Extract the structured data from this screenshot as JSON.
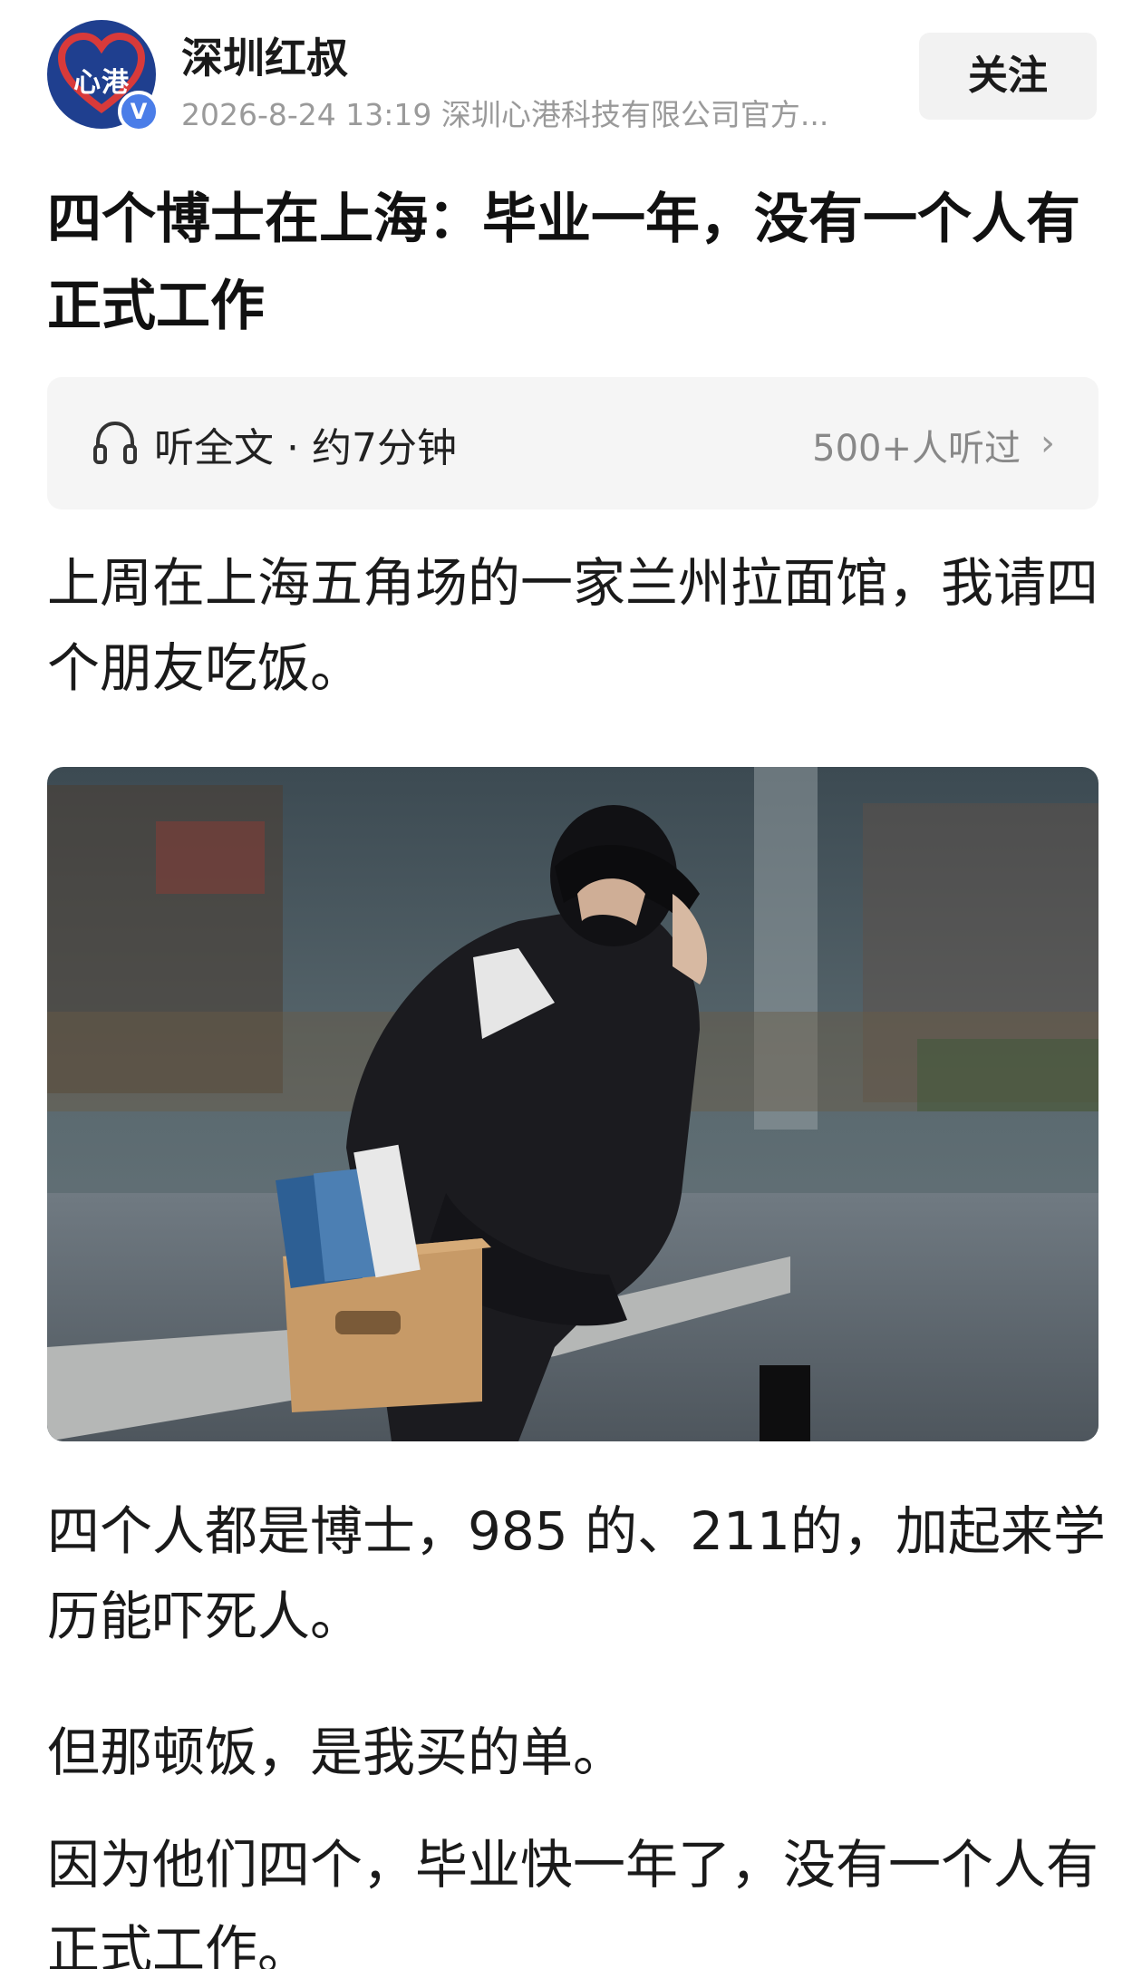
{
  "author": {
    "name": "深圳红叔",
    "avatar_text": "心港",
    "verified_mark": "V",
    "meta": "2026-8-24  13:19  深圳心港科技有限公司官方..."
  },
  "follow_label": "关注",
  "article": {
    "title": "四个博士在上海：毕业一年，没有一个人有正式工作",
    "listen": {
      "label": "听全文 · 约7分钟",
      "count": "500+人听过",
      "chevron": "›"
    },
    "paragraphs": [
      "上周在上海五角场的一家兰州拉面馆，我请四个朋友吃饭。",
      "四个人都是博士，985 的、211的，加起来学历能吓死人。",
      "但那顿饭，是我买的单。",
      "因为他们四个，毕业快一年了，没有一个人有正式工作。"
    ]
  },
  "colors": {
    "accent_blue": "#1f3f8f",
    "heart_red": "#d83a3a",
    "verified_blue": "#4a7de8"
  },
  "icons": {
    "listen": "headphones-icon",
    "verified": "verified-badge-icon"
  }
}
